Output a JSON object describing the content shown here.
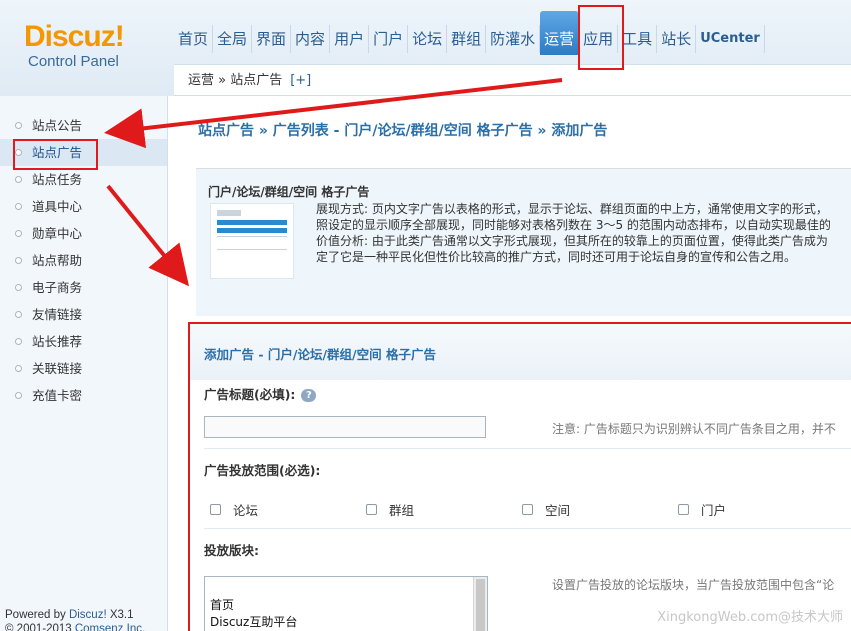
{
  "logo": {
    "brand": "Discuz",
    "bang": "!",
    "subtitle": "Control Panel"
  },
  "nav": {
    "items": [
      {
        "label": "首页"
      },
      {
        "label": "全局"
      },
      {
        "label": "界面"
      },
      {
        "label": "内容"
      },
      {
        "label": "用户"
      },
      {
        "label": "门户"
      },
      {
        "label": "论坛"
      },
      {
        "label": "群组"
      },
      {
        "label": "防灌水"
      },
      {
        "label": "运营",
        "active": true
      },
      {
        "label": "应用"
      },
      {
        "label": "工具"
      },
      {
        "label": "站长"
      },
      {
        "label": "UCenter"
      }
    ]
  },
  "breadcrumb": {
    "text": "运营 » 站点广告",
    "plus": "[+]"
  },
  "sidebar": {
    "items": [
      {
        "label": "站点公告"
      },
      {
        "label": "站点广告",
        "active": true
      },
      {
        "label": "站点任务"
      },
      {
        "label": "道具中心"
      },
      {
        "label": "勋章中心"
      },
      {
        "label": "站点帮助"
      },
      {
        "label": "电子商务"
      },
      {
        "label": "友情链接"
      },
      {
        "label": "站长推荐"
      },
      {
        "label": "关联链接"
      },
      {
        "label": "充值卡密"
      }
    ],
    "powered_prefix": "Powered by ",
    "powered_brand": "Discuz!",
    "powered_version": " X3.1",
    "copyright_prefix": "© 2001-2013 ",
    "copyright_link": "Comsenz Inc."
  },
  "main": {
    "title": "站点广告 » 广告列表 - 门户/论坛/群组/空间 格子广告 » 添加广告",
    "info": {
      "title": "门户/论坛/群组/空间 格子广告",
      "line1": "展现方式: 页内文字广告以表格的形式，显示于论坛、群组页面的中上方，通常使用文字的形式，",
      "line2": "照设定的显示顺序全部展现，同时能够对表格列数在 3～5 的范围内动态排布，以自动实现最佳的",
      "line3": "价值分析: 由于此类广告通常以文字形式展现，但其所在的较靠上的页面位置，使得此类广告成为",
      "line4": "定了它是一种平民化但性价比较高的推广方式，同时还可用于论坛自身的宣传和公告之用。"
    },
    "form": {
      "header": "添加广告 - 门户/论坛/群组/空间 格子广告",
      "title_label": "广告标题(必填):",
      "help_glyph": "?",
      "title_value": "",
      "title_note": "注意: 广告标题只为识别辨认不同广告条目之用，并不",
      "scope_label": "广告投放范围(必选):",
      "scope_options": [
        {
          "label": "论坛",
          "checked": false
        },
        {
          "label": "群组",
          "checked": false
        },
        {
          "label": "空间",
          "checked": false
        },
        {
          "label": "门户",
          "checked": false
        }
      ],
      "block_label": "投放版块:",
      "block_note": "设置广告投放的论坛版块，当广告投放范围中包含“论",
      "block_options": [
        {
          "label": "首页"
        },
        {
          "label": "Discuz互助平台"
        }
      ]
    }
  },
  "watermark": "XingkongWeb.com@技术大师",
  "colors": {
    "accent": "#2a6fa8",
    "highlight": "#e01a1a",
    "logo": "#f39800"
  }
}
